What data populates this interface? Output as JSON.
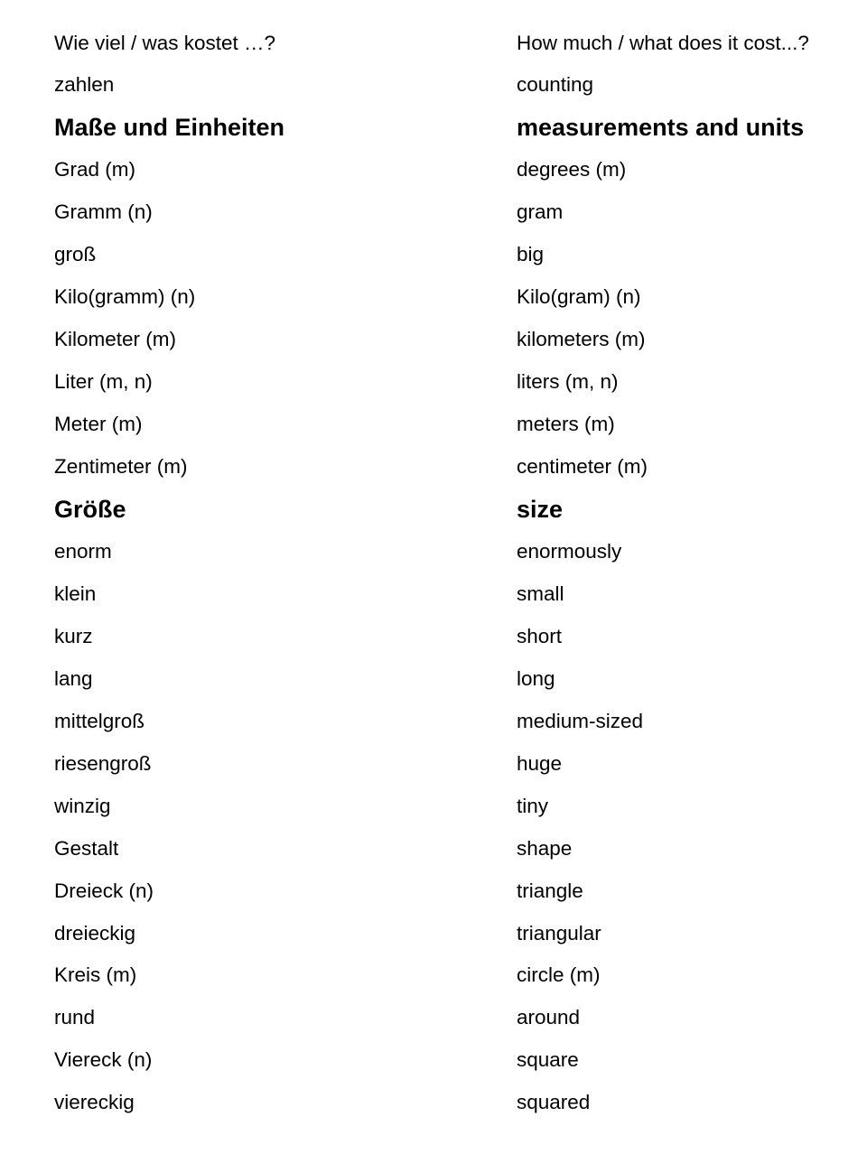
{
  "rows": [
    {
      "de": "Wie viel / was kostet …?",
      "en": "How much / what does it cost...?",
      "heading": false
    },
    {
      "de": "zahlen",
      "en": "counting",
      "heading": false
    },
    {
      "de": "Maße und Einheiten",
      "en": "measurements and units",
      "heading": true
    },
    {
      "de": "Grad (m)",
      "en": "degrees (m)",
      "heading": false
    },
    {
      "de": "Gramm (n)",
      "en": "gram",
      "heading": false
    },
    {
      "de": "groß",
      "en": "big",
      "heading": false
    },
    {
      "de": "Kilo(gramm) (n)",
      "en": "Kilo(gram) (n)",
      "heading": false
    },
    {
      "de": "Kilometer (m)",
      "en": "kilometers (m)",
      "heading": false
    },
    {
      "de": "Liter (m, n)",
      "en": "liters (m, n)",
      "heading": false
    },
    {
      "de": "Meter (m)",
      "en": "meters (m)",
      "heading": false
    },
    {
      "de": "Zentimeter (m)",
      "en": "centimeter (m)",
      "heading": false
    },
    {
      "de": "Größe",
      "en": "size",
      "heading": true
    },
    {
      "de": "enorm",
      "en": "enormously",
      "heading": false
    },
    {
      "de": "klein",
      "en": "small",
      "heading": false
    },
    {
      "de": "kurz",
      "en": "short",
      "heading": false
    },
    {
      "de": "lang",
      "en": "long",
      "heading": false
    },
    {
      "de": "mittelgroß",
      "en": "medium-sized",
      "heading": false
    },
    {
      "de": "riesengroß",
      "en": "huge",
      "heading": false
    },
    {
      "de": "winzig",
      "en": "tiny",
      "heading": false
    },
    {
      "de": "Gestalt",
      "en": "shape",
      "heading": false
    },
    {
      "de": "Dreieck (n)",
      "en": "triangle",
      "heading": false
    },
    {
      "de": "dreieckig",
      "en": "triangular",
      "heading": false
    },
    {
      "de": "Kreis (m)",
      "en": "circle (m)",
      "heading": false
    },
    {
      "de": "rund",
      "en": "around",
      "heading": false
    },
    {
      "de": "Viereck (n)",
      "en": "square",
      "heading": false
    },
    {
      "de": "viereckig",
      "en": "squared",
      "heading": false
    }
  ]
}
